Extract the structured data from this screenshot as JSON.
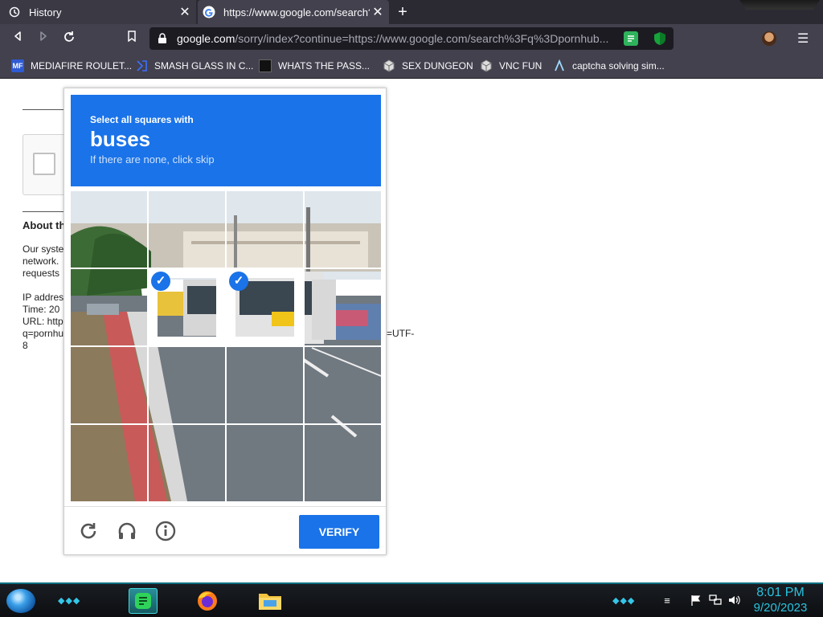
{
  "tabs": [
    {
      "title": "History",
      "icon": "history-clock-icon"
    },
    {
      "title": "https://www.google.com/search?q",
      "icon": "google-g-icon"
    }
  ],
  "address_bar": {
    "host": "google.com",
    "path": "/sorry/index?continue=https://www.google.com/search%3Fq%3Dpornhub..."
  },
  "bookmarks": [
    {
      "label": "MEDIAFIRE ROULET...",
      "icon": "mediafire-icon"
    },
    {
      "label": "SMASH GLASS IN C...",
      "icon": "bracket-icon"
    },
    {
      "label": "WHATS THE PASS...",
      "icon": "dark-square-icon"
    },
    {
      "label": "SEX DUNGEON",
      "icon": "cube-icon"
    },
    {
      "label": "VNC FUN",
      "icon": "cube-icon"
    },
    {
      "label": "captcha solving sim...",
      "icon": "lambda-icon"
    }
  ],
  "page": {
    "heading": "About th",
    "paragraph": "Our syste\nnetwork.\nrequests",
    "ip_block": "IP addres\nTime: 20\nURL: http\nq=pornhu\n8",
    "url_tail": "=UTF-"
  },
  "challenge": {
    "prompt": "Select all squares with",
    "object": "buses",
    "hint": "If there are none, click skip",
    "verify_label": "VERIFY",
    "selected_tiles": [
      5,
      6
    ],
    "check_glyph": "✓",
    "colors": {
      "header": "#1a73e8",
      "verify": "#1a73e8"
    }
  },
  "taskbar": {
    "time": "8:01 PM",
    "date": "9/20/2023",
    "apps": [
      "notepad-app-icon",
      "firefox-icon",
      "file-explorer-icon"
    ],
    "tray": [
      "flag-icon",
      "network-icon",
      "volume-icon"
    ]
  }
}
